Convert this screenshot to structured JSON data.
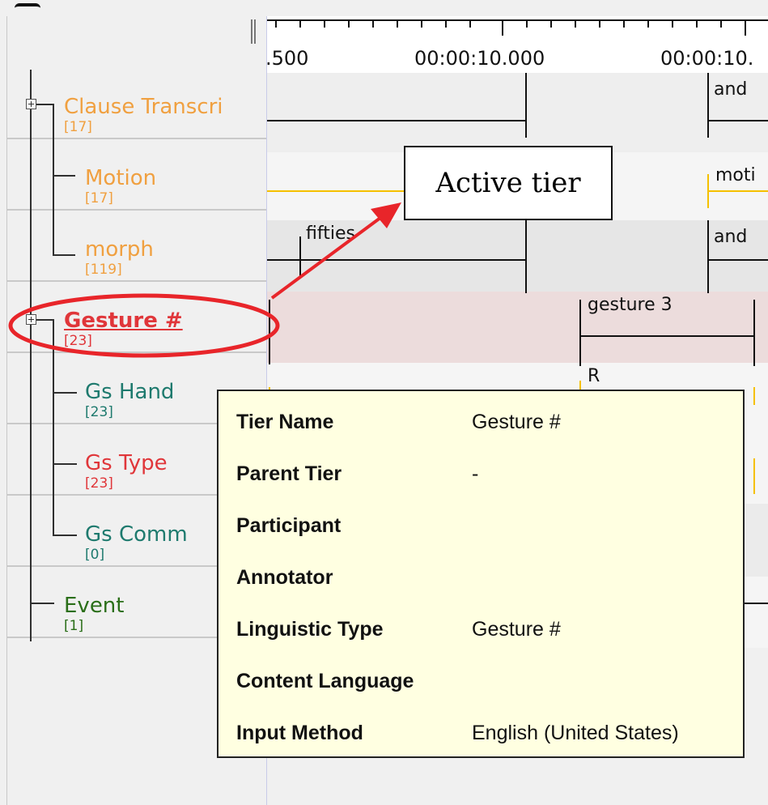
{
  "colors": {
    "tier_orange": "#f0a040",
    "tier_red": "#e0363a",
    "tier_teal": "#1e7a6e",
    "tier_green": "#2a6e18",
    "active_band": "#ecdcdc",
    "tooltip_bg": "#ffffe1",
    "highlight_red": "#e8252a",
    "yellow_line": "#f5c000"
  },
  "tiers": [
    {
      "name": "Clause Transcri",
      "count": "[17]",
      "color": "#f0a040"
    },
    {
      "name": "Motion",
      "count": "[17]",
      "color": "#f0a040"
    },
    {
      "name": "morph",
      "count": "[119]",
      "color": "#f0a040"
    },
    {
      "name": "Gesture #",
      "count": "[23]",
      "color": "#e0363a",
      "active": true
    },
    {
      "name": "Gs Hand",
      "count": "[23]",
      "color": "#1e7a6e"
    },
    {
      "name": "Gs Type",
      "count": "[23]",
      "color": "#e0363a"
    },
    {
      "name": "Gs Comm",
      "count": "[0]",
      "color": "#1e7a6e"
    },
    {
      "name": "Event",
      "count": "[1]",
      "color": "#2a6e18"
    }
  ],
  "ruler": {
    "labels": [
      ".500",
      "00:00:10.000",
      "00:00:10."
    ]
  },
  "annotations": {
    "clause_and": "and",
    "motion_moti": "moti",
    "morph_fifties": "fifties",
    "morph_and": "and",
    "gesture_3": "gesture 3",
    "gshand_r": "R"
  },
  "callout": {
    "text": "Active tier"
  },
  "tooltip": {
    "rows": [
      {
        "key": "Tier Name",
        "value": "Gesture #"
      },
      {
        "key": "Parent Tier",
        "value": "-"
      },
      {
        "key": "Participant",
        "value": ""
      },
      {
        "key": "Annotator",
        "value": ""
      },
      {
        "key": "Linguistic Type",
        "value": "Gesture #"
      },
      {
        "key": "Content Language",
        "value": ""
      },
      {
        "key": "Input Method",
        "value": "English (United States)"
      }
    ]
  }
}
